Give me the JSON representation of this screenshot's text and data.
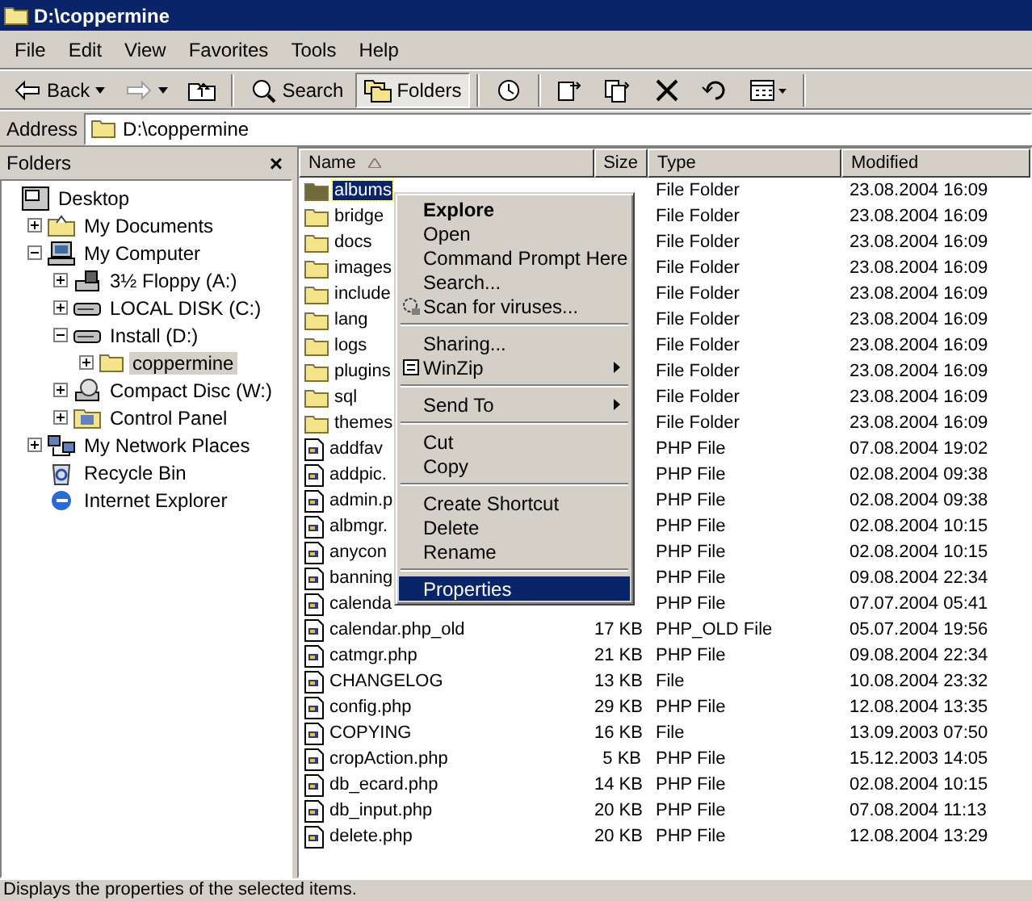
{
  "window": {
    "title": "D:\\coppermine"
  },
  "menu_bar": [
    "File",
    "Edit",
    "View",
    "Favorites",
    "Tools",
    "Help"
  ],
  "toolbar": [
    {
      "kind": "back",
      "label": "Back",
      "disabled": false
    },
    {
      "kind": "forward",
      "disabled": true
    },
    {
      "kind": "up",
      "disabled": false
    },
    {
      "kind": "search",
      "label": "Search",
      "selected": false
    },
    {
      "kind": "folders",
      "label": "Folders",
      "selected": true
    },
    {
      "kind": "history",
      "selected": false
    },
    {
      "kind": "move",
      "selected": false
    },
    {
      "kind": "copy",
      "selected": false
    },
    {
      "kind": "delete",
      "selected": false
    },
    {
      "kind": "undo",
      "selected": false
    },
    {
      "kind": "views",
      "selected": false
    }
  ],
  "address": {
    "label": "Address",
    "value": "D:\\coppermine"
  },
  "folders_pane": {
    "title": "Folders",
    "close": "×",
    "tree": [
      {
        "label": "Desktop",
        "kind": "desktop",
        "selected": false,
        "children": [
          {
            "label": "My Documents",
            "kind": "documents",
            "expanded": false,
            "selected": false
          },
          {
            "label": "My Computer",
            "kind": "computer",
            "expanded": true,
            "selected": false,
            "children": [
              {
                "label": "3½ Floppy (A:)",
                "kind": "floppy",
                "expanded": false,
                "selected": false
              },
              {
                "label": "LOCAL DISK (C:)",
                "kind": "disk",
                "expanded": false,
                "selected": false
              },
              {
                "label": "Install (D:)",
                "kind": "disk",
                "expanded": true,
                "selected": false,
                "children": [
                  {
                    "label": "coppermine",
                    "kind": "folder",
                    "expanded": false,
                    "selected": true
                  }
                ]
              },
              {
                "label": "Compact Disc (W:)",
                "kind": "cd",
                "expanded": false,
                "selected": false
              },
              {
                "label": "Control Panel",
                "kind": "control",
                "expanded": false,
                "selected": false
              }
            ]
          },
          {
            "label": "My Network Places",
            "kind": "network",
            "expanded": false,
            "selected": false
          },
          {
            "label": "Recycle Bin",
            "kind": "recycle",
            "selected": false
          },
          {
            "label": "Internet Explorer",
            "kind": "ie",
            "selected": false
          }
        ]
      }
    ]
  },
  "file_list": {
    "columns": [
      {
        "label": "Name",
        "sorted": true
      },
      {
        "label": "Size",
        "sorted": false
      },
      {
        "label": "Type",
        "sorted": false
      },
      {
        "label": "Modified",
        "sorted": false
      }
    ],
    "rows": [
      {
        "kind": "folder",
        "name": "albums",
        "type": "File Folder",
        "modified": "23.08.2004 16:09",
        "selected": true
      },
      {
        "kind": "folder",
        "name": "bridge",
        "type": "File Folder",
        "modified": "23.08.2004 16:09",
        "selected": false
      },
      {
        "kind": "folder",
        "name": "docs",
        "type": "File Folder",
        "modified": "23.08.2004 16:09",
        "selected": false
      },
      {
        "kind": "folder",
        "name": "images",
        "type": "File Folder",
        "modified": "23.08.2004 16:09",
        "selected": false
      },
      {
        "kind": "folder",
        "name": "include",
        "type": "File Folder",
        "modified": "23.08.2004 16:09",
        "selected": false
      },
      {
        "kind": "folder",
        "name": "lang",
        "type": "File Folder",
        "modified": "23.08.2004 16:09",
        "selected": false
      },
      {
        "kind": "folder",
        "name": "logs",
        "type": "File Folder",
        "modified": "23.08.2004 16:09",
        "selected": false
      },
      {
        "kind": "folder",
        "name": "plugins",
        "type": "File Folder",
        "modified": "23.08.2004 16:09",
        "selected": false
      },
      {
        "kind": "folder",
        "name": "sql",
        "type": "File Folder",
        "modified": "23.08.2004 16:09",
        "selected": false
      },
      {
        "kind": "folder",
        "name": "themes",
        "type": "File Folder",
        "modified": "23.08.2004 16:09",
        "selected": false
      },
      {
        "kind": "file",
        "name": "addfav",
        "type": "PHP File",
        "modified": "07.08.2004 19:02",
        "selected": false
      },
      {
        "kind": "file",
        "name": "addpic.",
        "type": "PHP File",
        "modified": "02.08.2004 09:38",
        "selected": false
      },
      {
        "kind": "file",
        "name": "admin.p",
        "type": "PHP File",
        "modified": "02.08.2004 09:38",
        "selected": false
      },
      {
        "kind": "file",
        "name": "albmgr.",
        "type": "PHP File",
        "modified": "02.08.2004 10:15",
        "selected": false
      },
      {
        "kind": "file",
        "name": "anycon",
        "type": "PHP File",
        "modified": "02.08.2004 10:15",
        "selected": false
      },
      {
        "kind": "file",
        "name": "banning",
        "type": "PHP File",
        "modified": "09.08.2004 22:34",
        "selected": false
      },
      {
        "kind": "file",
        "name": "calenda",
        "type": "PHP File",
        "modified": "07.07.2004 05:41",
        "selected": false
      },
      {
        "kind": "file",
        "name": "calendar.php_old",
        "size": "17 KB",
        "type": "PHP_OLD File",
        "modified": "05.07.2004 19:56",
        "selected": false
      },
      {
        "kind": "file",
        "name": "catmgr.php",
        "size": "21 KB",
        "type": "PHP File",
        "modified": "09.08.2004 22:34",
        "selected": false
      },
      {
        "kind": "file",
        "name": "CHANGELOG",
        "size": "13 KB",
        "type": "File",
        "modified": "10.08.2004 23:32",
        "selected": false
      },
      {
        "kind": "file",
        "name": "config.php",
        "size": "29 KB",
        "type": "PHP File",
        "modified": "12.08.2004 13:35",
        "selected": false
      },
      {
        "kind": "file",
        "name": "COPYING",
        "size": "16 KB",
        "type": "File",
        "modified": "13.09.2003 07:50",
        "selected": false
      },
      {
        "kind": "file",
        "name": "cropAction.php",
        "size": "5 KB",
        "type": "PHP File",
        "modified": "15.12.2003 14:05",
        "selected": false
      },
      {
        "kind": "file",
        "name": "db_ecard.php",
        "size": "14 KB",
        "type": "PHP File",
        "modified": "02.08.2004 10:15",
        "selected": false
      },
      {
        "kind": "file",
        "name": "db_input.php",
        "size": "20 KB",
        "type": "PHP File",
        "modified": "07.08.2004 11:13",
        "selected": false
      },
      {
        "kind": "file",
        "name": "delete.php",
        "size": "20 KB",
        "type": "PHP File",
        "modified": "12.08.2004 13:29",
        "selected": false
      }
    ]
  },
  "context_menu": [
    {
      "kind": "item",
      "label": "Explore",
      "default": true,
      "selected": false
    },
    {
      "kind": "item",
      "label": "Open",
      "selected": false
    },
    {
      "kind": "item",
      "label": "Command Prompt Here",
      "selected": false
    },
    {
      "kind": "item",
      "label": "Search...",
      "selected": false
    },
    {
      "kind": "scan",
      "label": "Scan for viruses...",
      "selected": false
    },
    {
      "kind": "separator"
    },
    {
      "kind": "item",
      "label": "Sharing...",
      "selected": false
    },
    {
      "kind": "winzip",
      "label": "WinZip",
      "submenu": true,
      "selected": false
    },
    {
      "kind": "separator"
    },
    {
      "kind": "item",
      "label": "Send To",
      "submenu": true,
      "selected": false
    },
    {
      "kind": "separator"
    },
    {
      "kind": "item",
      "label": "Cut",
      "selected": false
    },
    {
      "kind": "item",
      "label": "Copy",
      "selected": false
    },
    {
      "kind": "separator"
    },
    {
      "kind": "item",
      "label": "Create Shortcut",
      "selected": false
    },
    {
      "kind": "item",
      "label": "Delete",
      "selected": false
    },
    {
      "kind": "item",
      "label": "Rename",
      "selected": false
    },
    {
      "kind": "separator"
    },
    {
      "kind": "item",
      "label": "Properties",
      "selected": true
    }
  ],
  "status_bar": "Displays the properties of the selected items."
}
